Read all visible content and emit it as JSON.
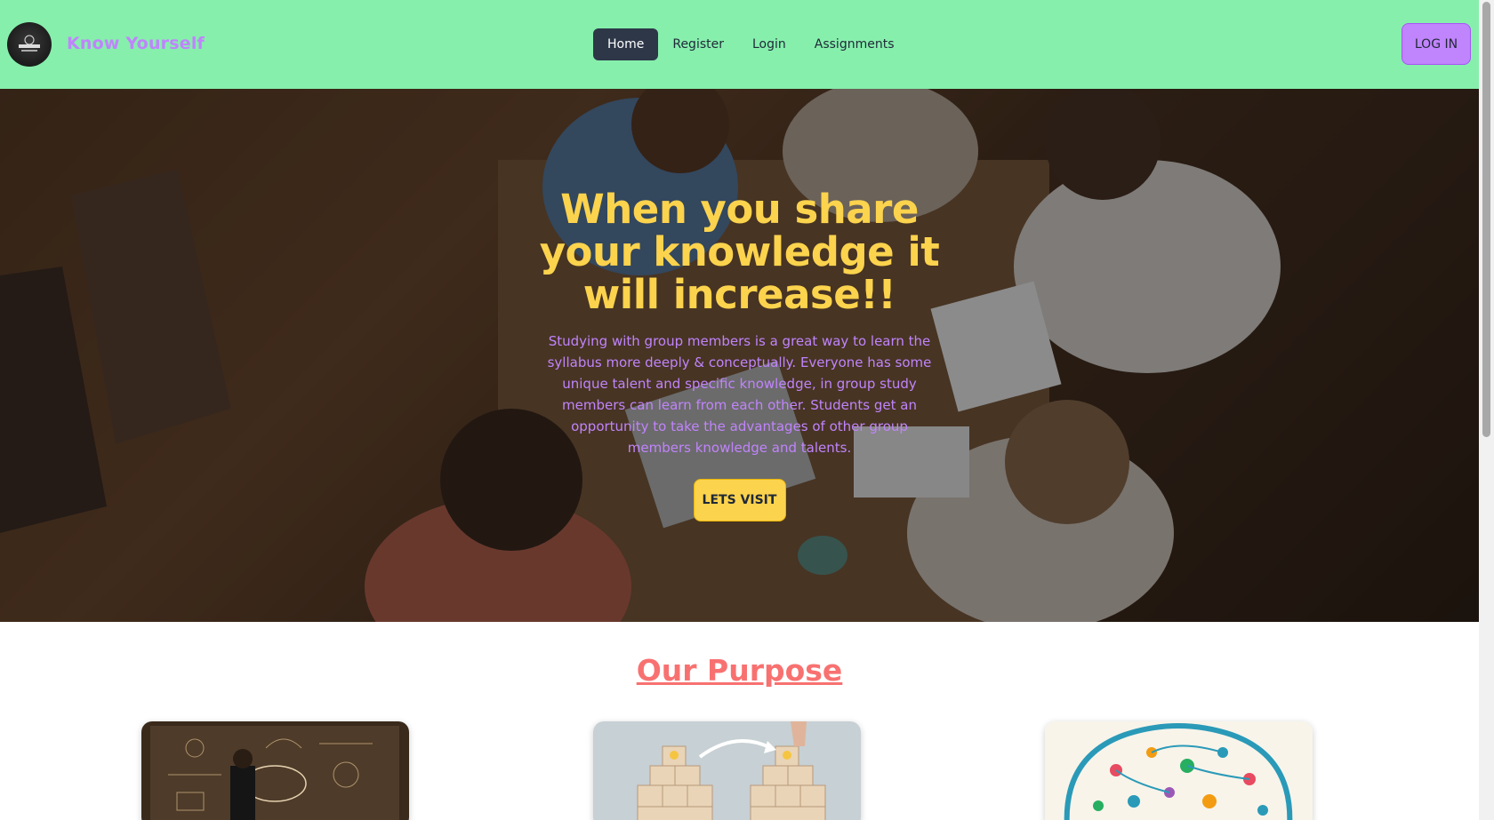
{
  "brand": {
    "name": "Know Yourself",
    "logo_text": "THE STUDY"
  },
  "nav": {
    "links": [
      {
        "label": "Home",
        "active": true
      },
      {
        "label": "Register",
        "active": false
      },
      {
        "label": "Login",
        "active": false
      },
      {
        "label": "Assignments",
        "active": false
      }
    ],
    "login_button": "LOG IN"
  },
  "hero": {
    "title": "When you share your knowledge it will increase!!",
    "text": "Studying with group members is a great way to learn the syllabus more deeply & conceptually. Everyone has some unique talent and specific knowledge, in group study members can learn from each other. Students get an opportunity to take the advantages of other group members knowledge and talents.",
    "button": "LETS VISIT"
  },
  "purpose": {
    "title": "Our Purpose",
    "cards": [
      {
        "image": "chalkboard-ideas-image"
      },
      {
        "image": "knowledge-blocks-image"
      },
      {
        "image": "brain-icons-image"
      }
    ]
  },
  "colors": {
    "navbar": "#86efac",
    "brand": "#c084fc",
    "hero_title": "#fcd34d",
    "hero_text": "#c084fc",
    "purpose_title": "#f87171"
  }
}
